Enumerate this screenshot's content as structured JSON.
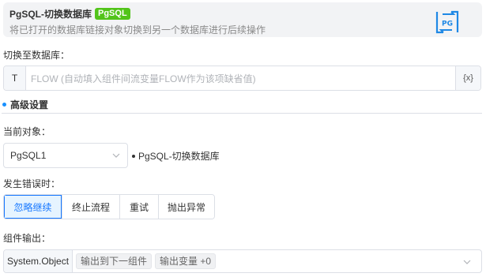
{
  "header": {
    "title": "PgSQL-切换数据库",
    "tag": "PgSQL",
    "description": "将已打开的数据库链接对象切换到另一个数据库进行后续操作",
    "icon": "pg-switch-icon"
  },
  "database_field": {
    "label": "切换至数据库：",
    "prefix": "T",
    "placeholder": "FLOW (自动填入组件间流变量FLOW作为该项缺省值)",
    "suffix": "{x}"
  },
  "advanced": {
    "title": "高级设置"
  },
  "current_object": {
    "label": "当前对象：",
    "value": "PgSQL1",
    "description": "PgSQL-切换数据库"
  },
  "on_error": {
    "label": "发生错误时：",
    "options": [
      "忽略继续",
      "终止流程",
      "重试",
      "抛出异常"
    ],
    "selected": "忽略继续"
  },
  "output": {
    "label": "组件输出：",
    "type": "System.Object",
    "chips": [
      "输出到下一组件",
      "输出变量 +0"
    ]
  },
  "colors": {
    "accent": "#1677ff",
    "tag_green": "#52c41a"
  }
}
